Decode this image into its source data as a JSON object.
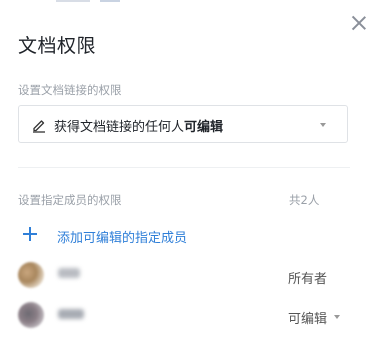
{
  "dialog": {
    "title": "文档权限",
    "close_icon": "close-icon"
  },
  "link_permission": {
    "section_label": "设置文档链接的权限",
    "icon": "pencil-icon",
    "text_prefix": "获得文档链接的任何人",
    "text_bold": "可编辑"
  },
  "members": {
    "section_label": "设置指定成员的权限",
    "count": "共2人",
    "add_label": "添加可编辑的指定成员",
    "list": [
      {
        "role": "所有者"
      },
      {
        "role": "可编辑"
      }
    ]
  },
  "colors": {
    "accent": "#2f7fd8",
    "muted": "#9aa0a8",
    "border": "#dfe2e6"
  }
}
